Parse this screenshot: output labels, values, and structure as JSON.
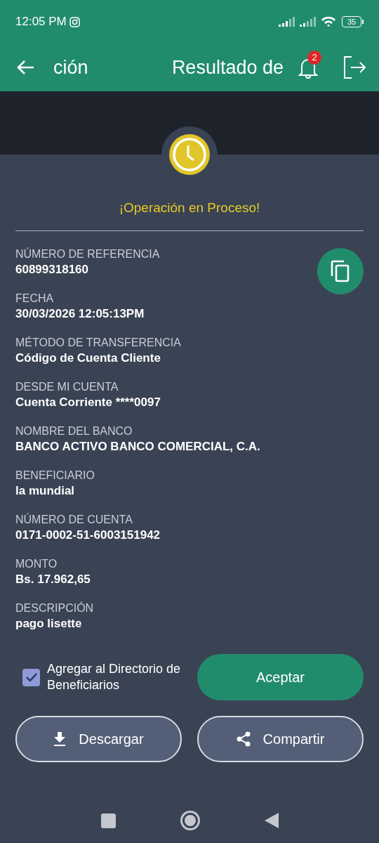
{
  "status_bar": {
    "time": "12:05 PM",
    "battery": "35"
  },
  "header": {
    "title_fragment": "ción",
    "title": "Resultado de",
    "notifications": "2"
  },
  "result": {
    "message": "¡Operación en Proceso!"
  },
  "fields": [
    {
      "label": "NÚMERO DE REFERENCIA",
      "value": "60899318160"
    },
    {
      "label": "FECHA",
      "value": "30/03/2026 12:05:13PM"
    },
    {
      "label": "MÉTODO DE TRANSFERENCIA",
      "value": "Código de Cuenta Cliente"
    },
    {
      "label": "DESDE MI CUENTA",
      "value": "Cuenta Corriente ****0097"
    },
    {
      "label": "NOMBRE DEL BANCO",
      "value": "BANCO ACTIVO BANCO COMERCIAL, C.A."
    },
    {
      "label": "BENEFICIARIO",
      "value": "la mundial"
    },
    {
      "label": "NÚMERO DE CUENTA",
      "value": "0171-0002-51-6003151942"
    },
    {
      "label": "MONTO",
      "value": "Bs. 17.962,65"
    },
    {
      "label": "DESCRIPCIÓN",
      "value": "pago lisette"
    }
  ],
  "add_to_directory": {
    "label": "Agregar al Directorio de Beneficiarios",
    "checked": true
  },
  "buttons": [
    {
      "kind": "primary",
      "label": "Aceptar"
    },
    {
      "kind": "download",
      "label": "Descargar"
    },
    {
      "kind": "share",
      "label": "Compartir"
    }
  ]
}
